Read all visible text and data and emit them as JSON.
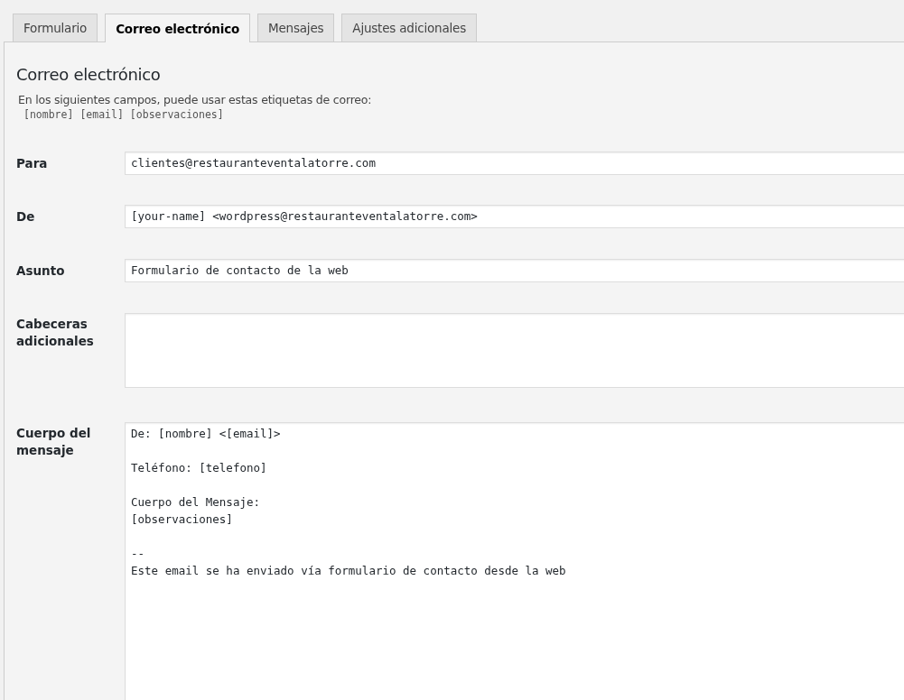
{
  "tabs": [
    {
      "label": "Formulario",
      "selected": false
    },
    {
      "label": "Correo electrónico",
      "selected": true
    },
    {
      "label": "Mensajes",
      "selected": false
    },
    {
      "label": "Ajustes adicionales",
      "selected": false
    }
  ],
  "panel": {
    "title": "Correo electrónico",
    "description": "En los siguientes campos, puede usar estas etiquetas de correo:",
    "mail_tags": [
      "[nombre]",
      "[email]",
      "[observaciones]"
    ]
  },
  "fields": [
    {
      "kind": "input",
      "label": "Para",
      "value": "clientes@restauranteventalatorre.com"
    },
    {
      "kind": "input",
      "label": "De",
      "value": "[your-name] <wordpress@restauranteventalatorre.com>"
    },
    {
      "kind": "input",
      "label": "Asunto",
      "value": "Formulario de contacto de la web"
    },
    {
      "kind": "textarea",
      "label": "Cabeceras adicionales"
    },
    {
      "kind": "body",
      "label": "Cuerpo del mensaje",
      "value": "De: [nombre] <[email]>\n\nTeléfono: [telefono]\n\nCuerpo del Mensaje:\n[observaciones]\n\n--\nEste email se ha enviado vía formulario de contacto desde la web"
    }
  ]
}
